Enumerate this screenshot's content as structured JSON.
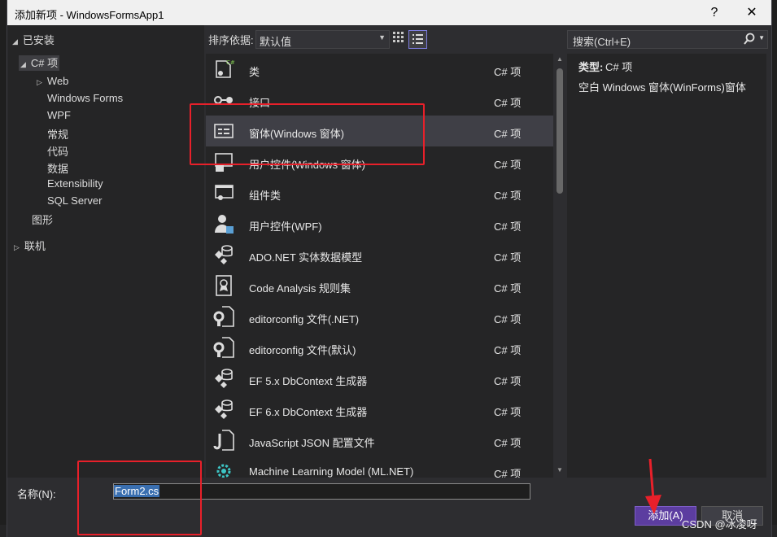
{
  "window": {
    "title": "添加新项 - WindowsFormsApp1",
    "help_label": "?",
    "close_label": "✕"
  },
  "left_panel": {
    "installed": "已安装",
    "items": [
      {
        "label": "C# 项",
        "level": 1,
        "arrow": "◢",
        "selected": true
      },
      {
        "label": "Web",
        "level": 2,
        "arrow": "▷"
      },
      {
        "label": "Windows Forms",
        "level": 2
      },
      {
        "label": "WPF",
        "level": 2
      },
      {
        "label": "常规",
        "level": 2
      },
      {
        "label": "代码",
        "level": 2
      },
      {
        "label": "数据",
        "level": 2
      },
      {
        "label": "Extensibility",
        "level": 2
      },
      {
        "label": "SQL Server",
        "level": 2
      },
      {
        "label": "图形",
        "level": 1
      }
    ],
    "online": "联机"
  },
  "toolbar": {
    "sort_label": "排序依据:",
    "sort_value": "默认值",
    "grid_view_icon": "grid-view-icon",
    "list_view_icon": "list-view-icon"
  },
  "templates": [
    {
      "name": "类",
      "lang": "C# 项",
      "icon": "class-icon"
    },
    {
      "name": "接口",
      "lang": "C# 项",
      "icon": "interface-icon"
    },
    {
      "name": "窗体(Windows 窗体)",
      "lang": "C# 项",
      "icon": "form-icon",
      "selected": true
    },
    {
      "name": "用户控件(Windows 窗体)",
      "lang": "C# 项",
      "icon": "user-control-icon"
    },
    {
      "name": "组件类",
      "lang": "C# 项",
      "icon": "component-icon"
    },
    {
      "name": "用户控件(WPF)",
      "lang": "C# 项",
      "icon": "wpf-user-control-icon"
    },
    {
      "name": "ADO.NET 实体数据模型",
      "lang": "C# 项",
      "icon": "data-model-icon"
    },
    {
      "name": "Code Analysis 规则集",
      "lang": "C# 项",
      "icon": "ruleset-icon"
    },
    {
      "name": "editorconfig 文件(.NET)",
      "lang": "C# 项",
      "icon": "config-file-icon"
    },
    {
      "name": "editorconfig 文件(默认)",
      "lang": "C# 项",
      "icon": "config-file-icon"
    },
    {
      "name": "EF 5.x DbContext 生成器",
      "lang": "C# 项",
      "icon": "generator-icon"
    },
    {
      "name": "EF 6.x DbContext 生成器",
      "lang": "C# 项",
      "icon": "generator-icon"
    },
    {
      "name": "JavaScript JSON 配置文件",
      "lang": "C# 项",
      "icon": "json-file-icon"
    },
    {
      "name": "Machine Learning Model (ML.NET)",
      "lang": "C# 项",
      "icon": "ml-model-icon"
    }
  ],
  "search": {
    "placeholder": "搜索(Ctrl+E)"
  },
  "details": {
    "type_label": "类型:",
    "type_value": "C# 项",
    "description": "空白 Windows 窗体(WinForms)窗体"
  },
  "bottom": {
    "name_label": "名称(N):",
    "name_value": "Form2.cs",
    "add_label": "添加(A)",
    "cancel_label": "取消"
  },
  "watermark": "CSDN @冰凌呀",
  "colors": {
    "accent": "#5c3da0",
    "annotation": "#e8202a",
    "selection": "#3f3f46"
  }
}
